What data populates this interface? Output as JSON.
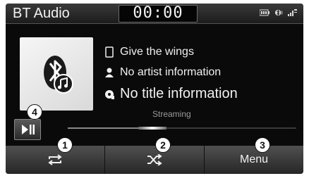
{
  "status_bar": {
    "app_title": "BT Audio",
    "clock": "00:00",
    "icons": [
      "battery-icon",
      "bluetooth-phone-icon",
      "signal-icon"
    ]
  },
  "track": {
    "song": "Give the wings",
    "artist": "No artist information",
    "title": "No title information",
    "status": "Streaming"
  },
  "playback": {
    "progress_fraction": 0.33
  },
  "controls": {
    "play_pause_icon": "play-pause-icon",
    "repeat_icon": "repeat-icon",
    "shuffle_icon": "shuffle-icon",
    "menu_label": "Menu"
  },
  "callouts": [
    "1",
    "2",
    "3",
    "4"
  ],
  "colors": {
    "screen_bg": "#0a0a0a",
    "text": "#f0f0f0",
    "muted_text": "#9a9a9a",
    "badge_bg": "#ffffff"
  }
}
